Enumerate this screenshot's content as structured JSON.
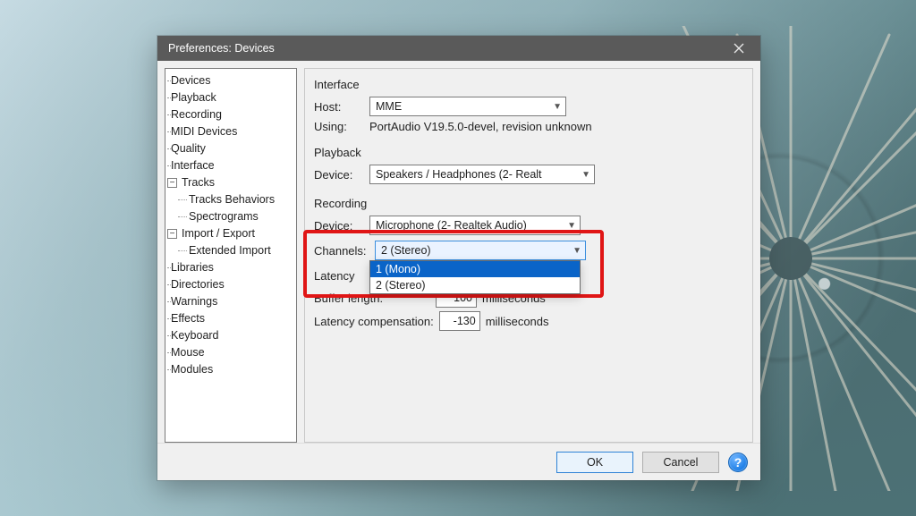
{
  "window": {
    "title": "Preferences: Devices"
  },
  "tree": {
    "items": [
      {
        "label": "Devices",
        "level": 0
      },
      {
        "label": "Playback",
        "level": 0
      },
      {
        "label": "Recording",
        "level": 0
      },
      {
        "label": "MIDI Devices",
        "level": 0
      },
      {
        "label": "Quality",
        "level": 0
      },
      {
        "label": "Interface",
        "level": 0
      },
      {
        "label": "Tracks",
        "level": 0,
        "children": true
      },
      {
        "label": "Tracks Behaviors",
        "level": 1
      },
      {
        "label": "Spectrograms",
        "level": 1
      },
      {
        "label": "Import / Export",
        "level": 0,
        "children": true
      },
      {
        "label": "Extended Import",
        "level": 1
      },
      {
        "label": "Libraries",
        "level": 0
      },
      {
        "label": "Directories",
        "level": 0
      },
      {
        "label": "Warnings",
        "level": 0
      },
      {
        "label": "Effects",
        "level": 0
      },
      {
        "label": "Keyboard",
        "level": 0
      },
      {
        "label": "Mouse",
        "level": 0
      },
      {
        "label": "Modules",
        "level": 0
      }
    ]
  },
  "interface": {
    "title": "Interface",
    "host_label": "Host:",
    "host_value": "MME",
    "using_label": "Using:",
    "using_value": "PortAudio V19.5.0-devel, revision unknown"
  },
  "playback": {
    "title": "Playback",
    "device_label": "Device:",
    "device_value": "Speakers / Headphones (2- Realt"
  },
  "recording": {
    "title": "Recording",
    "device_label": "Device:",
    "device_value": "Microphone (2- Realtek Audio)",
    "channels_label": "Channels:",
    "channels_value": "2 (Stereo)",
    "channels_options": [
      "1 (Mono)",
      "2 (Stereo)"
    ],
    "channels_option0": "1 (Mono)",
    "channels_option1": "2 (Stereo)"
  },
  "latency": {
    "title": "Latency",
    "buffer_label": "Buffer length:",
    "buffer_value": "100",
    "buffer_units": "milliseconds",
    "comp_label": "Latency compensation:",
    "comp_value": "-130",
    "comp_units": "milliseconds"
  },
  "footer": {
    "ok": "OK",
    "cancel": "Cancel",
    "help": "?"
  }
}
